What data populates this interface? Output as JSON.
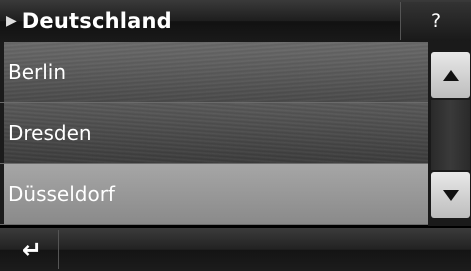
{
  "header": {
    "title": "Deutschland",
    "arrow": "▶",
    "help_label": "?"
  },
  "list": {
    "items": [
      {
        "label": "Berlin",
        "selected": false
      },
      {
        "label": "Dresden",
        "selected": false
      },
      {
        "label": "Düsseldorf",
        "selected": true
      }
    ]
  },
  "scrollbar": {
    "up_icon": "triangle-up",
    "down_icon": "triangle-down"
  },
  "bottom_bar": {
    "back_glyph": "↵",
    "back_icon": "return-arrow-icon"
  },
  "colors": {
    "selected_row": "#9a9a9a",
    "row": "#555555",
    "scroll_button": "#d6d6d6"
  }
}
